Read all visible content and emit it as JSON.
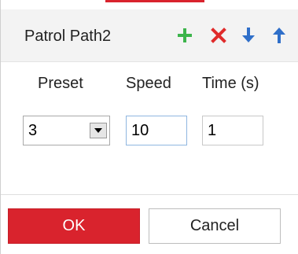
{
  "header": {
    "title": "Patrol Path2",
    "actions": [
      {
        "name": "add",
        "icon": "plus-icon",
        "color": "#3cb44b"
      },
      {
        "name": "delete",
        "icon": "close-icon",
        "color": "#e02b2b"
      },
      {
        "name": "move-down",
        "icon": "arrow-down-icon",
        "color": "#2f6fc9"
      },
      {
        "name": "move-up",
        "icon": "arrow-up-icon",
        "color": "#2f6fc9"
      }
    ]
  },
  "table": {
    "columns": [
      "Preset",
      "Speed",
      "Time (s)"
    ],
    "row": {
      "preset": "3",
      "speed": "10",
      "time": "1"
    }
  },
  "footer": {
    "ok_label": "OK",
    "cancel_label": "Cancel"
  },
  "colors": {
    "accent": "#d9232d",
    "header_bg": "#f3f3f3"
  }
}
